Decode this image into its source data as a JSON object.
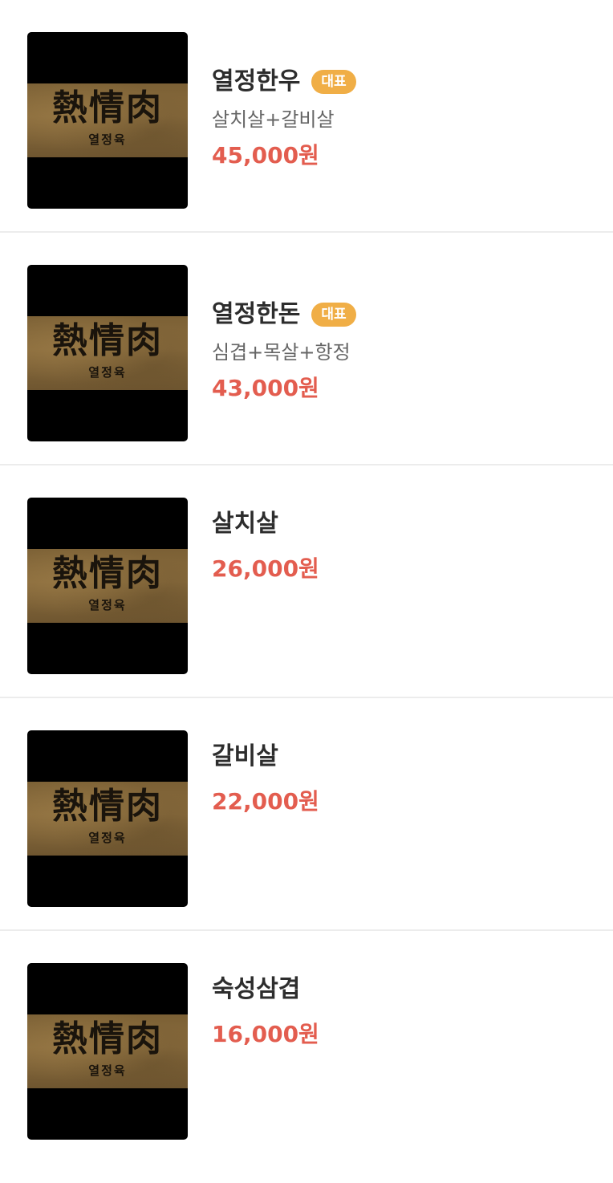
{
  "menu": {
    "items": [
      {
        "name": "열정한우",
        "badge": "대표",
        "description": "살치살+갈비살",
        "price": "45,000원",
        "image": {
          "hanja": "熱情肉",
          "hangul": "열정육"
        }
      },
      {
        "name": "열정한돈",
        "badge": "대표",
        "description": "심겹+목살+항정",
        "price": "43,000원",
        "image": {
          "hanja": "熱情肉",
          "hangul": "열정육"
        }
      },
      {
        "name": "살치살",
        "price": "26,000원",
        "image": {
          "hanja": "熱情肉",
          "hangul": "열정육"
        }
      },
      {
        "name": "갈비살",
        "price": "22,000원",
        "image": {
          "hanja": "熱情肉",
          "hangul": "열정육"
        }
      },
      {
        "name": "숙성삼겹",
        "price": "16,000원",
        "image": {
          "hanja": "熱情肉",
          "hangul": "열정육"
        }
      }
    ]
  },
  "colors": {
    "badge": "#f0ae46",
    "price": "#e35d4f",
    "name": "#2d2d2d",
    "description": "#666666",
    "divider": "#ececec"
  }
}
